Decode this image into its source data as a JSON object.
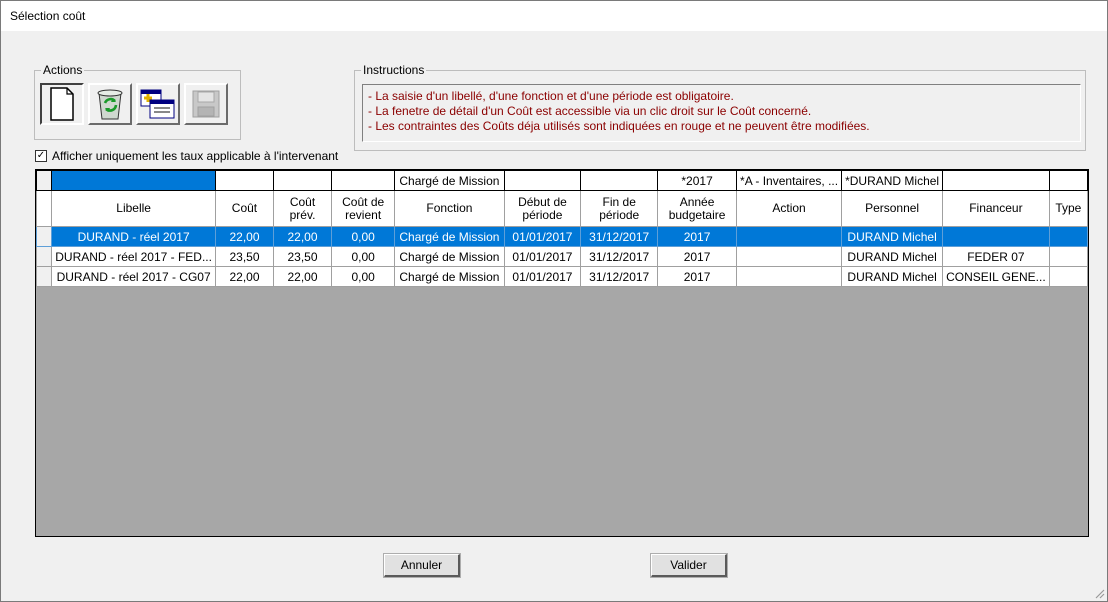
{
  "window": {
    "title": "Sélection coût"
  },
  "actions": {
    "legend": "Actions",
    "buttons": [
      {
        "name": "new-button",
        "icon": "new-document-icon"
      },
      {
        "name": "delete-button",
        "icon": "recycle-bin-icon"
      },
      {
        "name": "add-row-button",
        "icon": "add-window-icon"
      },
      {
        "name": "save-button",
        "icon": "floppy-disk-icon"
      }
    ]
  },
  "instructions": {
    "legend": "Instructions",
    "lines": [
      "- La saisie d'un libellé, d'une fonction et d'une période est obligatoire.",
      "- La fenetre de détail d'un Coût est accessible via un clic droit sur le Coût concerné.",
      "- Les contraintes des Coûts déja utilisés sont indiquées en rouge et ne peuvent être modifiées."
    ],
    "text_color": "#8b0000"
  },
  "filter_checkbox": {
    "label": "Afficher uniquement les taux applicable à l'intervenant",
    "checked": true
  },
  "grid": {
    "filters": [
      "",
      "",
      "",
      "",
      "Chargé de Mission",
      "",
      "",
      "*2017",
      "*A - Inventaires, ...",
      "*DURAND Michel",
      "",
      ""
    ],
    "columns": [
      "Libelle",
      "Coût",
      "Coût prév.",
      "Coût de revient",
      "Fonction",
      "Début de période",
      "Fin de période",
      "Année budgetaire",
      "Action",
      "Personnel",
      "Financeur",
      "Type"
    ],
    "rows": [
      [
        "DURAND - réel 2017",
        "22,00",
        "22,00",
        "0,00",
        "Chargé de Mission",
        "01/01/2017",
        "31/12/2017",
        "2017",
        "",
        "DURAND Michel",
        "",
        ""
      ],
      [
        "DURAND - réel 2017 - FED...",
        "23,50",
        "23,50",
        "0,00",
        "Chargé de Mission",
        "01/01/2017",
        "31/12/2017",
        "2017",
        "",
        "DURAND Michel",
        "FEDER 07",
        ""
      ],
      [
        "DURAND - réel 2017 - CG07",
        "22,00",
        "22,00",
        "0,00",
        "Chargé de Mission",
        "01/01/2017",
        "31/12/2017",
        "2017",
        "",
        "DURAND Michel",
        "CONSEIL GENE...",
        ""
      ]
    ],
    "selected_row": 0,
    "selection_color": "#0078d7"
  },
  "footer": {
    "cancel_label": "Annuler",
    "ok_label": "Valider"
  }
}
